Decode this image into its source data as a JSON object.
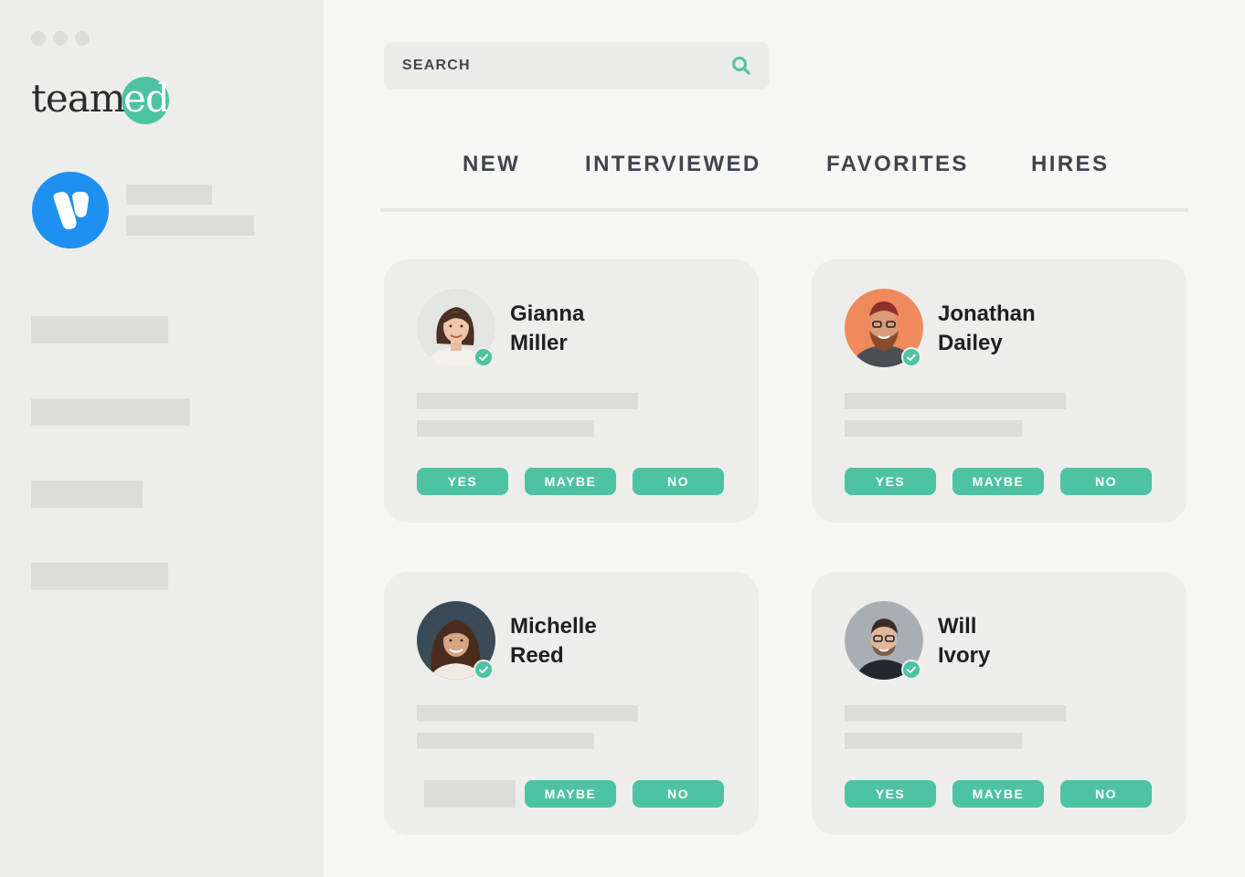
{
  "window": {
    "controls": [
      "dot",
      "dot",
      "dot"
    ]
  },
  "brand": {
    "logo_left": "team",
    "logo_right": "ed",
    "accent": "#4ec3a1"
  },
  "org": {
    "avatar_color": "#1f8ff2",
    "icon": "v-logo-icon"
  },
  "search": {
    "label": "SEARCH",
    "icon": "search-icon"
  },
  "tabs": [
    {
      "label": "NEW"
    },
    {
      "label": "INTERVIEWED"
    },
    {
      "label": "FAVORITES"
    },
    {
      "label": "HIRES"
    }
  ],
  "candidates": [
    {
      "first": "Gianna",
      "last": "Miller",
      "verified": true,
      "actions": {
        "yes": "YES",
        "maybe": "MAYBE",
        "no": "NO"
      }
    },
    {
      "first": "Jonathan",
      "last": "Dailey",
      "verified": true,
      "actions": {
        "yes": "YES",
        "maybe": "MAYBE",
        "no": "NO"
      }
    },
    {
      "first": "Michelle",
      "last": "Reed",
      "verified": true,
      "actions": {
        "maybe": "MAYBE",
        "no": "NO"
      }
    },
    {
      "first": "Will",
      "last": "Ivory",
      "verified": true,
      "actions": {
        "yes": "YES",
        "maybe": "MAYBE",
        "no": "NO"
      }
    }
  ]
}
